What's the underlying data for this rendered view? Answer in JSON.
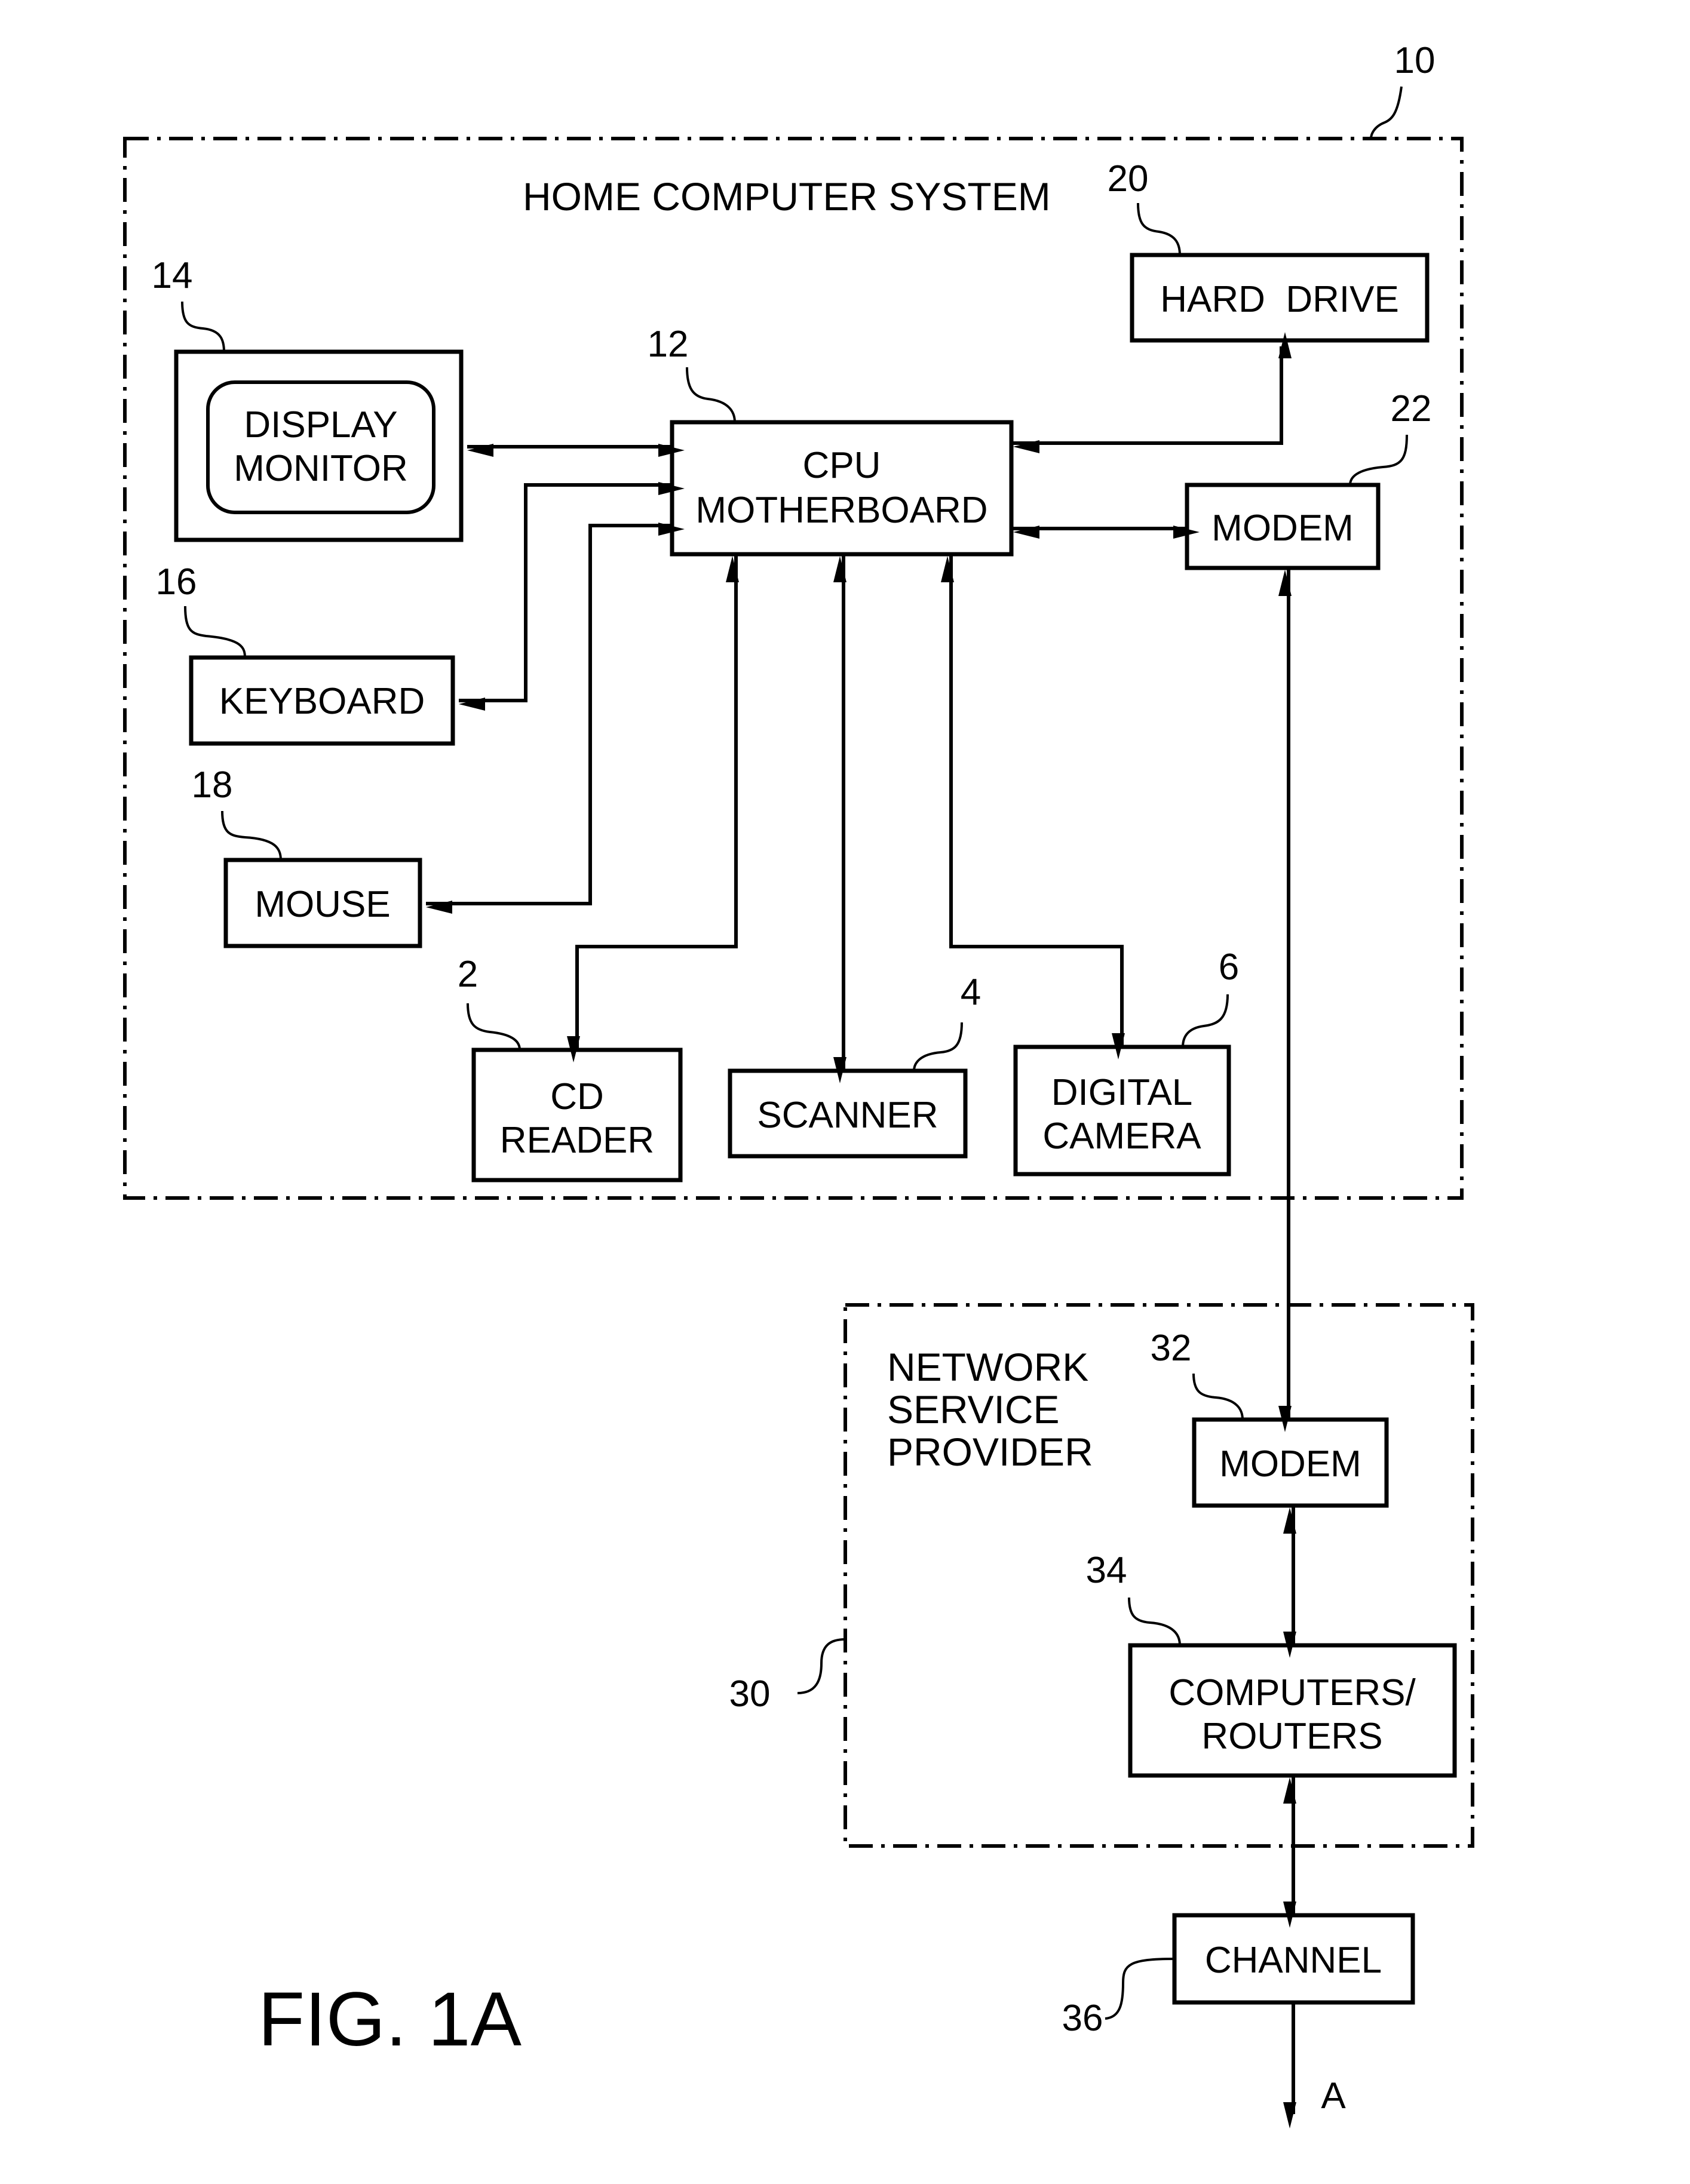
{
  "figure_label": "FIG. 1A",
  "groups": {
    "home": {
      "title": "HOME COMPUTER SYSTEM",
      "ref": "10"
    },
    "network": {
      "title_lines": [
        "NETWORK",
        "SERVICE",
        "PROVIDER"
      ],
      "ref": "30"
    }
  },
  "components": {
    "display": {
      "lines": [
        "DISPLAY",
        "MONITOR"
      ],
      "ref": "14"
    },
    "cpu": {
      "lines": [
        "CPU",
        "MOTHERBOARD"
      ],
      "ref": "12"
    },
    "hard_drive": {
      "lines": [
        "HARD  DRIVE"
      ],
      "ref": "20"
    },
    "modem_home": {
      "lines": [
        "MODEM"
      ],
      "ref": "22"
    },
    "keyboard": {
      "lines": [
        "KEYBOARD"
      ],
      "ref": "16"
    },
    "mouse": {
      "lines": [
        "MOUSE"
      ],
      "ref": "18"
    },
    "cd_reader": {
      "lines": [
        "CD",
        "READER"
      ],
      "ref": "2"
    },
    "scanner": {
      "lines": [
        "SCANNER"
      ],
      "ref": "4"
    },
    "camera": {
      "lines": [
        "DIGITAL",
        "CAMERA"
      ],
      "ref": "6"
    },
    "modem_isp": {
      "lines": [
        "MODEM"
      ],
      "ref": "32"
    },
    "routers": {
      "lines": [
        "COMPUTERS/",
        "ROUTERS"
      ],
      "ref": "34"
    },
    "channel": {
      "lines": [
        "CHANNEL"
      ],
      "ref": "36"
    }
  },
  "connections": [
    {
      "from": "display",
      "to": "cpu",
      "direction": "bidirectional"
    },
    {
      "from": "cpu",
      "to": "keyboard",
      "direction": "bidirectional"
    },
    {
      "from": "cpu",
      "to": "mouse",
      "direction": "bidirectional"
    },
    {
      "from": "cpu",
      "to": "hard_drive",
      "direction": "bidirectional"
    },
    {
      "from": "cpu",
      "to": "modem_home",
      "direction": "bidirectional"
    },
    {
      "from": "cpu",
      "to": "cd_reader",
      "direction": "bidirectional"
    },
    {
      "from": "cpu",
      "to": "scanner",
      "direction": "bidirectional"
    },
    {
      "from": "cpu",
      "to": "camera",
      "direction": "bidirectional"
    },
    {
      "from": "modem_home",
      "to": "modem_isp",
      "direction": "bidirectional"
    },
    {
      "from": "modem_isp",
      "to": "routers",
      "direction": "bidirectional"
    },
    {
      "from": "routers",
      "to": "channel",
      "direction": "bidirectional"
    },
    {
      "from": "channel",
      "to": "offpage_A",
      "direction": "forward"
    }
  ],
  "offpage_connector": "A"
}
